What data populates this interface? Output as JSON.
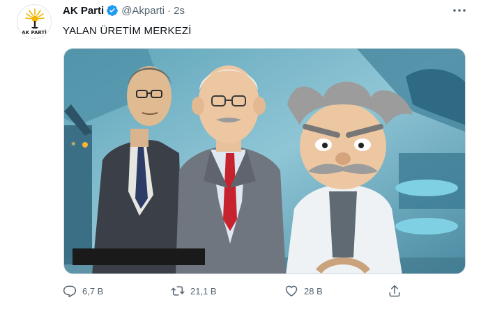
{
  "tweet": {
    "author_name": "AK Parti",
    "handle": "@Akparti",
    "separator": "·",
    "time": "2s",
    "text": "YALAN ÜRETİM MERKEZİ",
    "avatar_logo_text": "AK PARTİ",
    "verified": true
  },
  "actions": {
    "reply_count": "6,7 B",
    "retweet_count": "21,1 B",
    "like_count": "28 B"
  },
  "icons": {
    "more": "more-dots-icon",
    "reply": "reply-icon",
    "retweet": "retweet-icon",
    "like": "heart-icon",
    "share": "share-icon",
    "verified": "verified-badge-icon"
  },
  "colors": {
    "verified_blue": "#1d9bf0",
    "secondary_text": "#536471",
    "logo_yellow": "#f5b400"
  }
}
